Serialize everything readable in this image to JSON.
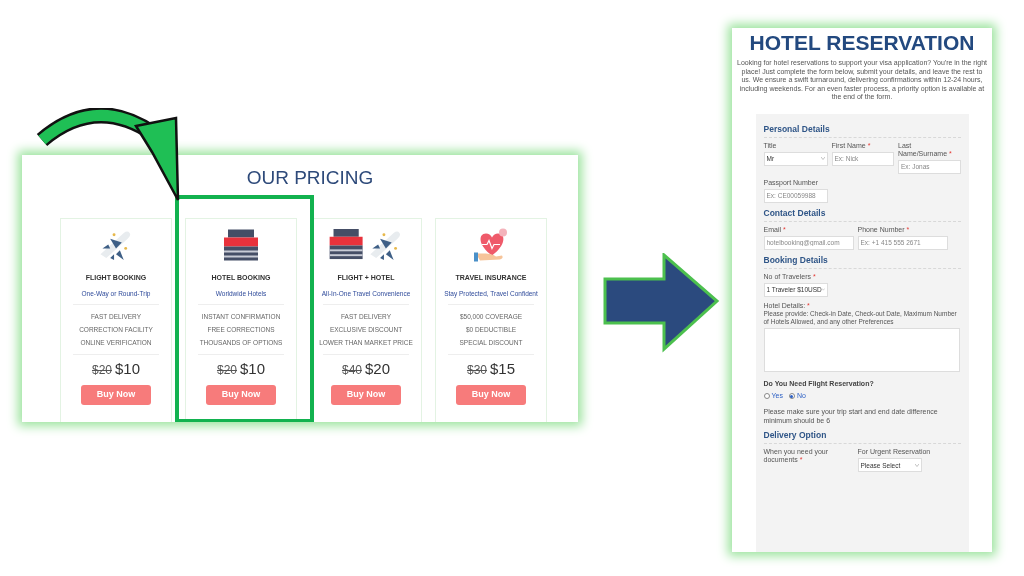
{
  "pricing": {
    "title": "OUR PRICING",
    "plans": [
      {
        "name": "FLIGHT BOOKING",
        "subtitle": "One-Way or Round-Trip",
        "features": [
          "FAST DELIVERY",
          "CORRECTION FACILITY",
          "ONLINE VERIFICATION"
        ],
        "old_price": "$20",
        "price": "$10",
        "button": "Buy Now",
        "highlighted": false
      },
      {
        "name": "HOTEL BOOKING",
        "subtitle": "Worldwide Hotels",
        "features": [
          "INSTANT CONFIRMATION",
          "FREE CORRECTIONS",
          "THOUSANDS OF OPTIONS"
        ],
        "old_price": "$20",
        "price": "$10",
        "button": "Buy Now",
        "highlighted": true
      },
      {
        "name": "FLIGHT + HOTEL",
        "subtitle": "All-In-One Travel Convenience",
        "features": [
          "FAST DELIVERY",
          "EXCLUSIVE DISCOUNT",
          "LOWER THAN MARKET PRICE"
        ],
        "old_price": "$40",
        "price": "$20",
        "button": "Buy Now",
        "highlighted": false
      },
      {
        "name": "TRAVEL INSURANCE",
        "subtitle": "Stay Protected, Travel Confident",
        "features": [
          "$50,000 COVERAGE",
          "$0 DEDUCTIBLE",
          "SPECIAL DISCOUNT"
        ],
        "old_price": "$30",
        "price": "$15",
        "button": "Buy Now",
        "highlighted": false
      }
    ]
  },
  "reservation": {
    "title": "HOTEL RESERVATION",
    "intro": "Looking for hotel reservations to support your visa application? You're in the right place! Just complete the form below, submit your details, and leave the rest to us. We ensure a swift turnaround, delivering confirmations within 12-24 hours, including weekends. For an even faster process, a priority option is available at the end of the form.",
    "sections": [
      {
        "title": "Personal Details",
        "items": [
          {
            "kind": "fields",
            "fields": [
              {
                "kind": "select",
                "label": "Title",
                "value": "Mr"
              },
              {
                "kind": "input",
                "label": "First Name",
                "required_mark": "*",
                "placeholder": "Ex: Nick"
              },
              {
                "kind": "input",
                "label": "Last Name/Surname",
                "required_mark": "*",
                "placeholder": "Ex: Jonas"
              }
            ]
          },
          {
            "kind": "fields",
            "fields": [
              {
                "kind": "input",
                "label": "Passport Number",
                "placeholder": "Ex: CE00059988"
              }
            ]
          }
        ]
      },
      {
        "title": "Contact Details",
        "items": [
          {
            "kind": "fields",
            "fields": [
              {
                "kind": "input",
                "label": "Email",
                "required_mark": "*",
                "placeholder": "hotelbooking@gmail.com"
              },
              {
                "kind": "input",
                "label": "Phone Number",
                "required_mark": "*",
                "placeholder": "Ex: +1 415 555 2671"
              }
            ]
          }
        ]
      },
      {
        "title": "Booking Details",
        "items": [
          {
            "kind": "fields",
            "fields": [
              {
                "kind": "select",
                "label": "No of Travelers",
                "required_mark": "*",
                "value": "1 Traveler $10USD"
              }
            ]
          },
          {
            "kind": "textarea",
            "label": "Hotel Details:",
            "required_mark": "*",
            "help": "Please provide: Check-in Date, Check-out Date, Maximum Number of Hotels Allowed, and any other Preferences"
          },
          {
            "kind": "radio",
            "label": "Do You Need Flight Reservation?",
            "options": [
              {
                "label": "Yes",
                "selected": false
              },
              {
                "label": "No",
                "selected": true
              }
            ]
          },
          {
            "kind": "note",
            "text": "Please make sure your trip start and end date difference minimum should be 6"
          }
        ]
      },
      {
        "title": "Delivery Option",
        "items": [
          {
            "kind": "fields",
            "fields": [
              {
                "kind": "label",
                "label": "When you need your documents",
                "required_mark": "*"
              },
              {
                "kind": "select",
                "label": "For Urgent Reservation",
                "value": "Please Select"
              }
            ]
          }
        ]
      }
    ]
  }
}
